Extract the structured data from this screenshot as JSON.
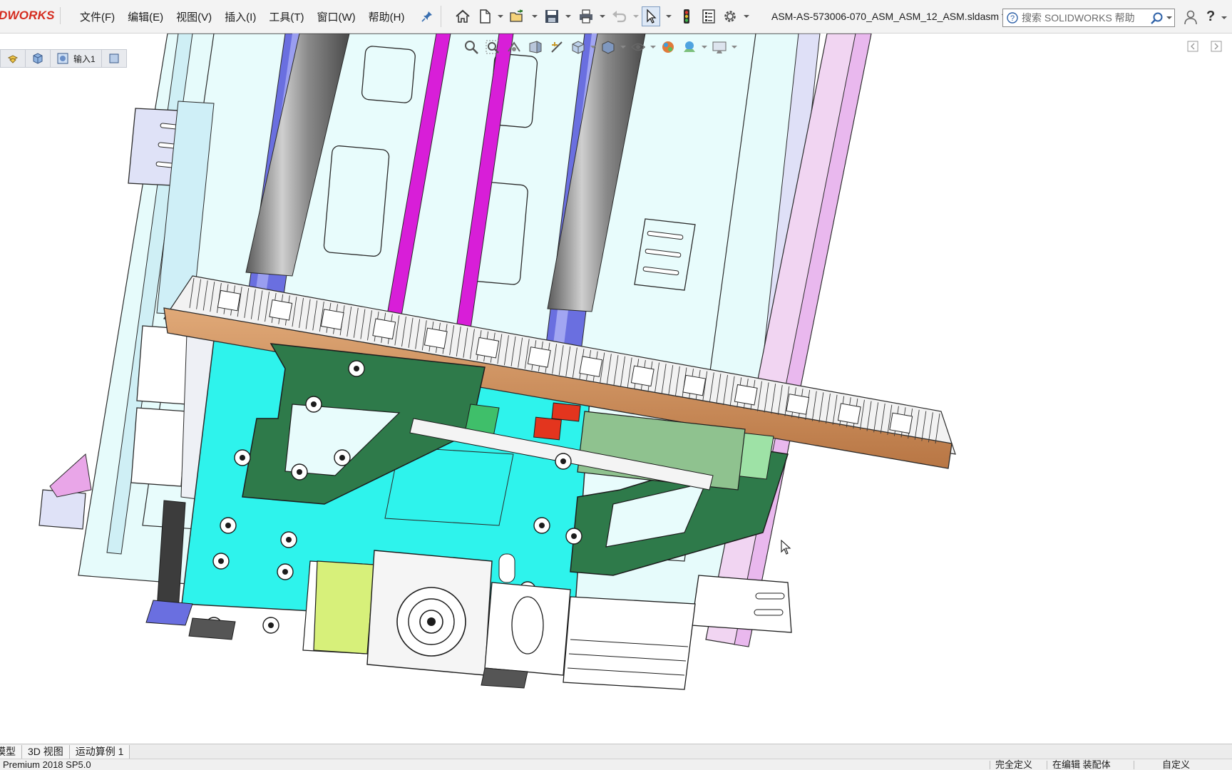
{
  "app": {
    "logo_text": "DWORKS",
    "document_title": "ASM-AS-573006-070_ASM_ASM_12_ASM.sldasm *"
  },
  "menu": [
    {
      "label": "文件(F)"
    },
    {
      "label": "编辑(E)"
    },
    {
      "label": "视图(V)"
    },
    {
      "label": "插入(I)"
    },
    {
      "label": "工具(T)"
    },
    {
      "label": "窗口(W)"
    },
    {
      "label": "帮助(H)"
    }
  ],
  "toolbar": {
    "icons": [
      "home-icon",
      "new-document-icon",
      "open-folder-icon",
      "save-icon",
      "print-icon",
      "undo-icon",
      "select-arrow-icon",
      "traffic-light-icon",
      "file-properties-icon",
      "options-gear-icon"
    ]
  },
  "search": {
    "placeholder": "搜索 SOLIDWORKS 帮助"
  },
  "breadcrumb": {
    "segments": [
      {
        "icon": "assembly-icon"
      },
      {
        "icon": "part-icon"
      },
      {
        "icon": "feature-icon",
        "label": "输入1"
      },
      {
        "icon": "sketch-icon"
      }
    ]
  },
  "bottom_tabs": [
    {
      "label": "模型"
    },
    {
      "label": "3D 视图"
    },
    {
      "label": "运动算例 1"
    }
  ],
  "status": {
    "version": "Premium 2018 SP5.0",
    "definition": "完全定义",
    "editing": "在编辑 装配体",
    "units": "自定义"
  },
  "colors": {
    "brand_red": "#d52b1e",
    "cyan_plate": "#2ef3ec",
    "green_bracket": "#2e7a4a",
    "magenta_rail": "#d81ed8",
    "copper_board": "#c98a5a",
    "blue_rail": "#5a5fd8"
  }
}
